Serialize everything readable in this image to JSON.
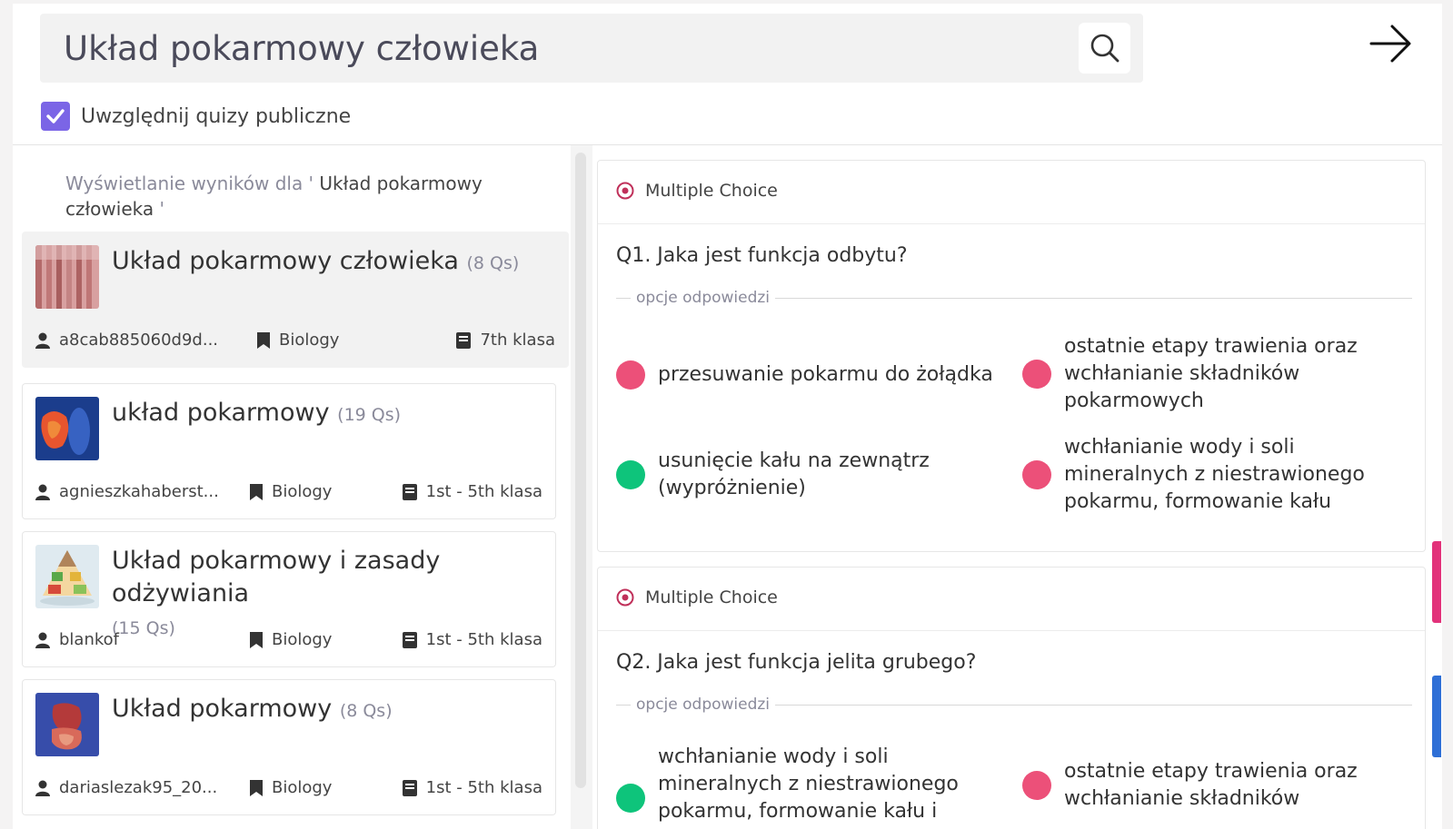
{
  "search": {
    "value": "Układ pokarmowy człowieka",
    "icon": "search-icon"
  },
  "public_toggle": {
    "checked": true,
    "label": "Uwzględnij quizy publiczne"
  },
  "results": {
    "prefix": "Wyświetlanie wyników dla ' ",
    "query": "Układ pokarmowy człowieka",
    "suffix": " '"
  },
  "quizzes": [
    {
      "title": "Układ pokarmowy człowieka",
      "count": "(8 Qs)",
      "author": "a8cab885060d9d...",
      "subject": "Biology",
      "grade": "7th klasa"
    },
    {
      "title": "układ pokarmowy",
      "count": "(19 Qs)",
      "author": "agnieszkahaberst...",
      "subject": "Biology",
      "grade": "1st - 5th klasa"
    },
    {
      "title": "Układ pokarmowy i zasady odżywiania",
      "count": "(15 Qs)",
      "author": "blankof",
      "subject": "Biology",
      "grade": "1st - 5th klasa"
    },
    {
      "title": "Układ pokarmowy",
      "count": "(8 Qs)",
      "author": "dariaslezak95_20...",
      "subject": "Biology",
      "grade": "1st - 5th klasa"
    }
  ],
  "questions": [
    {
      "type": "Multiple Choice",
      "text": "Q1. Jaka jest funkcja odbytu?",
      "options_label": "opcje odpowiedzi",
      "options": [
        {
          "text": "przesuwanie pokarmu do żołądka",
          "correct": false
        },
        {
          "text": "ostatnie etapy trawienia oraz wchłanianie składników pokarmowych",
          "correct": false
        },
        {
          "text": "usunięcie kału na zewnątrz (wypróżnienie)",
          "correct": true
        },
        {
          "text": "wchłanianie wody i soli mineralnych z niestrawionego pokarmu, formowanie kału",
          "correct": false
        }
      ]
    },
    {
      "type": "Multiple Choice",
      "text": "Q2. Jaka jest funkcja jelita grubego?",
      "options_label": "opcje odpowiedzi",
      "options": [
        {
          "text": "wchłanianie wody i soli mineralnych z niestrawionego pokarmu, formowanie kału i przesuwanie go",
          "correct": true
        },
        {
          "text": "ostatnie etapy trawienia oraz wchłanianie składników",
          "correct": false
        }
      ]
    }
  ],
  "colors": {
    "accent": "#7b65e6",
    "correct": "#0ec47b",
    "wrong": "#ec5079",
    "type_icon": "#c0305a"
  }
}
